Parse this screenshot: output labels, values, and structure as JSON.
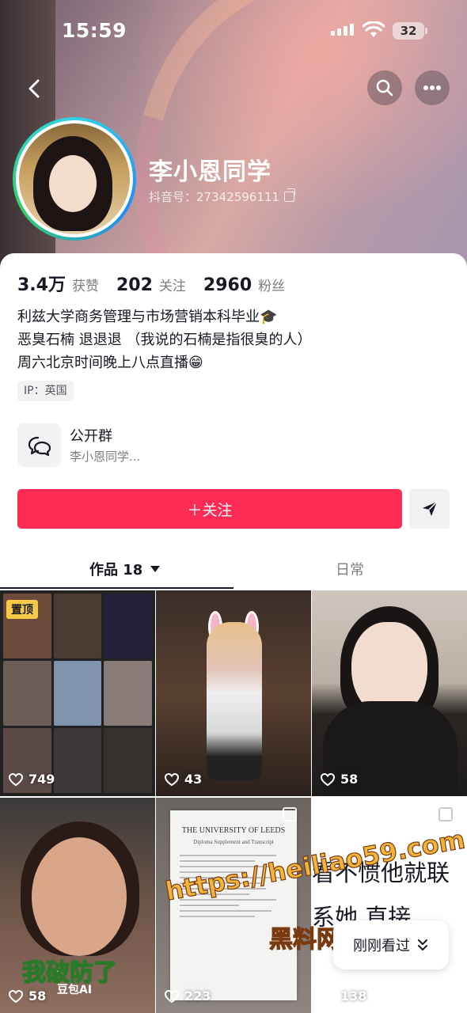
{
  "status_bar": {
    "time": "15:59",
    "battery": "32"
  },
  "profile": {
    "name": "李小恩同学",
    "douyin_id": "抖音号：27342596111",
    "stats": [
      {
        "num": "3.4万",
        "label": "获赞"
      },
      {
        "num": "202",
        "label": "关注"
      },
      {
        "num": "2960",
        "label": "粉丝"
      }
    ],
    "bio": [
      "利兹大学商务管理与市场营销本科毕业🎓",
      "恶臭石楠 退退退 （我说的石楠是指很臭的人）",
      "周六北京时间晚上八点直播😁"
    ],
    "ip": "IP：英国"
  },
  "group": {
    "title": "公开群",
    "subtitle": "李小恩同学..."
  },
  "actions": {
    "follow": "＋关注"
  },
  "tabs": {
    "works": "作品 18",
    "daily": "日常"
  },
  "grid": [
    {
      "likes": "749",
      "pinned": "置顶"
    },
    {
      "likes": "43"
    },
    {
      "likes": "58"
    },
    {
      "likes": "58",
      "caption": "我破防了",
      "brand": "豆包AI"
    },
    {
      "likes": "223",
      "doc_title": "THE UNIVERSITY OF LEEDS",
      "doc_sub": "Diploma Supplement and Transcript"
    },
    {
      "likes": "138",
      "text_line1": "看不惯他就联",
      "text_line2": "系她 直接"
    }
  ],
  "watermark": {
    "url": "https://heiliao59.com",
    "name": "黑料网"
  },
  "recent": {
    "label": "刚刚看过"
  },
  "colors": {
    "accent": "#fe2c55",
    "pin": "#f7c948"
  }
}
